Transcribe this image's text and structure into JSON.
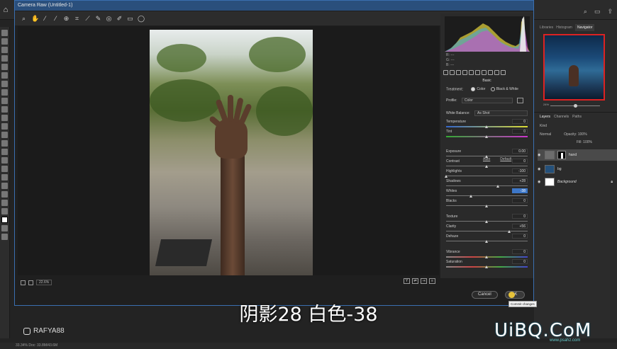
{
  "dialog": {
    "title": "Camera Raw (Untitled-1)",
    "zoom": "22.6%",
    "cancel_label": "Cancel",
    "ok_label": "OK",
    "tooltip": "Commit changes"
  },
  "panel": {
    "section": "Basic",
    "rgb_labels": [
      "R:",
      "G:",
      "B:"
    ],
    "rgb_values": [
      "---",
      "---",
      "---"
    ],
    "treatment_label": "Treatment:",
    "color_option": "Color",
    "bw_option": "Black & White",
    "profile_label": "Profile:",
    "profile_value": "Color",
    "wb_label": "White Balance:",
    "wb_value": "As Shot",
    "auto_link": "Auto",
    "default_link": "Default",
    "sliders": [
      {
        "label": "Temperature",
        "value": "0",
        "pos": 0.5,
        "track": "temp"
      },
      {
        "label": "Tint",
        "value": "0",
        "pos": 0.5,
        "track": "tint"
      },
      {
        "label": "Exposure",
        "value": "0.00",
        "pos": 0.5,
        "track": "plain"
      },
      {
        "label": "Contrast",
        "value": "0",
        "pos": 0.5,
        "track": "plain"
      },
      {
        "label": "Highlights",
        "value": "-100",
        "pos": 0.0,
        "track": "plain"
      },
      {
        "label": "Shadows",
        "value": "+28",
        "pos": 0.64,
        "track": "plain"
      },
      {
        "label": "Whites",
        "value": "-38",
        "pos": 0.31,
        "track": "plain",
        "highlight": true
      },
      {
        "label": "Blacks",
        "value": "0",
        "pos": 0.5,
        "track": "plain"
      },
      {
        "label": "Texture",
        "value": "0",
        "pos": 0.5,
        "track": "plain"
      },
      {
        "label": "Clarity",
        "value": "+56",
        "pos": 0.78,
        "track": "plain"
      },
      {
        "label": "Dehaze",
        "value": "0",
        "pos": 0.5,
        "track": "plain"
      },
      {
        "label": "Vibrance",
        "value": "0",
        "pos": 0.5,
        "track": "sat"
      },
      {
        "label": "Saturation",
        "value": "0",
        "pos": 0.5,
        "track": "sat"
      }
    ]
  },
  "ps": {
    "panel_tabs": [
      "Libraries",
      "Histogram",
      "Navigator"
    ],
    "layers_tabs": [
      "Layers",
      "Channels",
      "Paths"
    ],
    "kind_label": "Kind",
    "blend_mode": "Normal",
    "opacity_label": "Opacity:",
    "opacity_value": "100%",
    "fill_label": "Fill:",
    "fill_value": "100%",
    "nav_zoom": "24%",
    "layers": [
      {
        "name": "hand"
      },
      {
        "name": "bg"
      },
      {
        "name": "Background"
      }
    ],
    "status": "33.34%    Doc: 33.8M/43.6M"
  },
  "caption": "阴影28 白色-38",
  "watermark": {
    "instagram": "RAFYA88",
    "brand": "UiBQ.CoM",
    "url": "www.psahz.com"
  }
}
